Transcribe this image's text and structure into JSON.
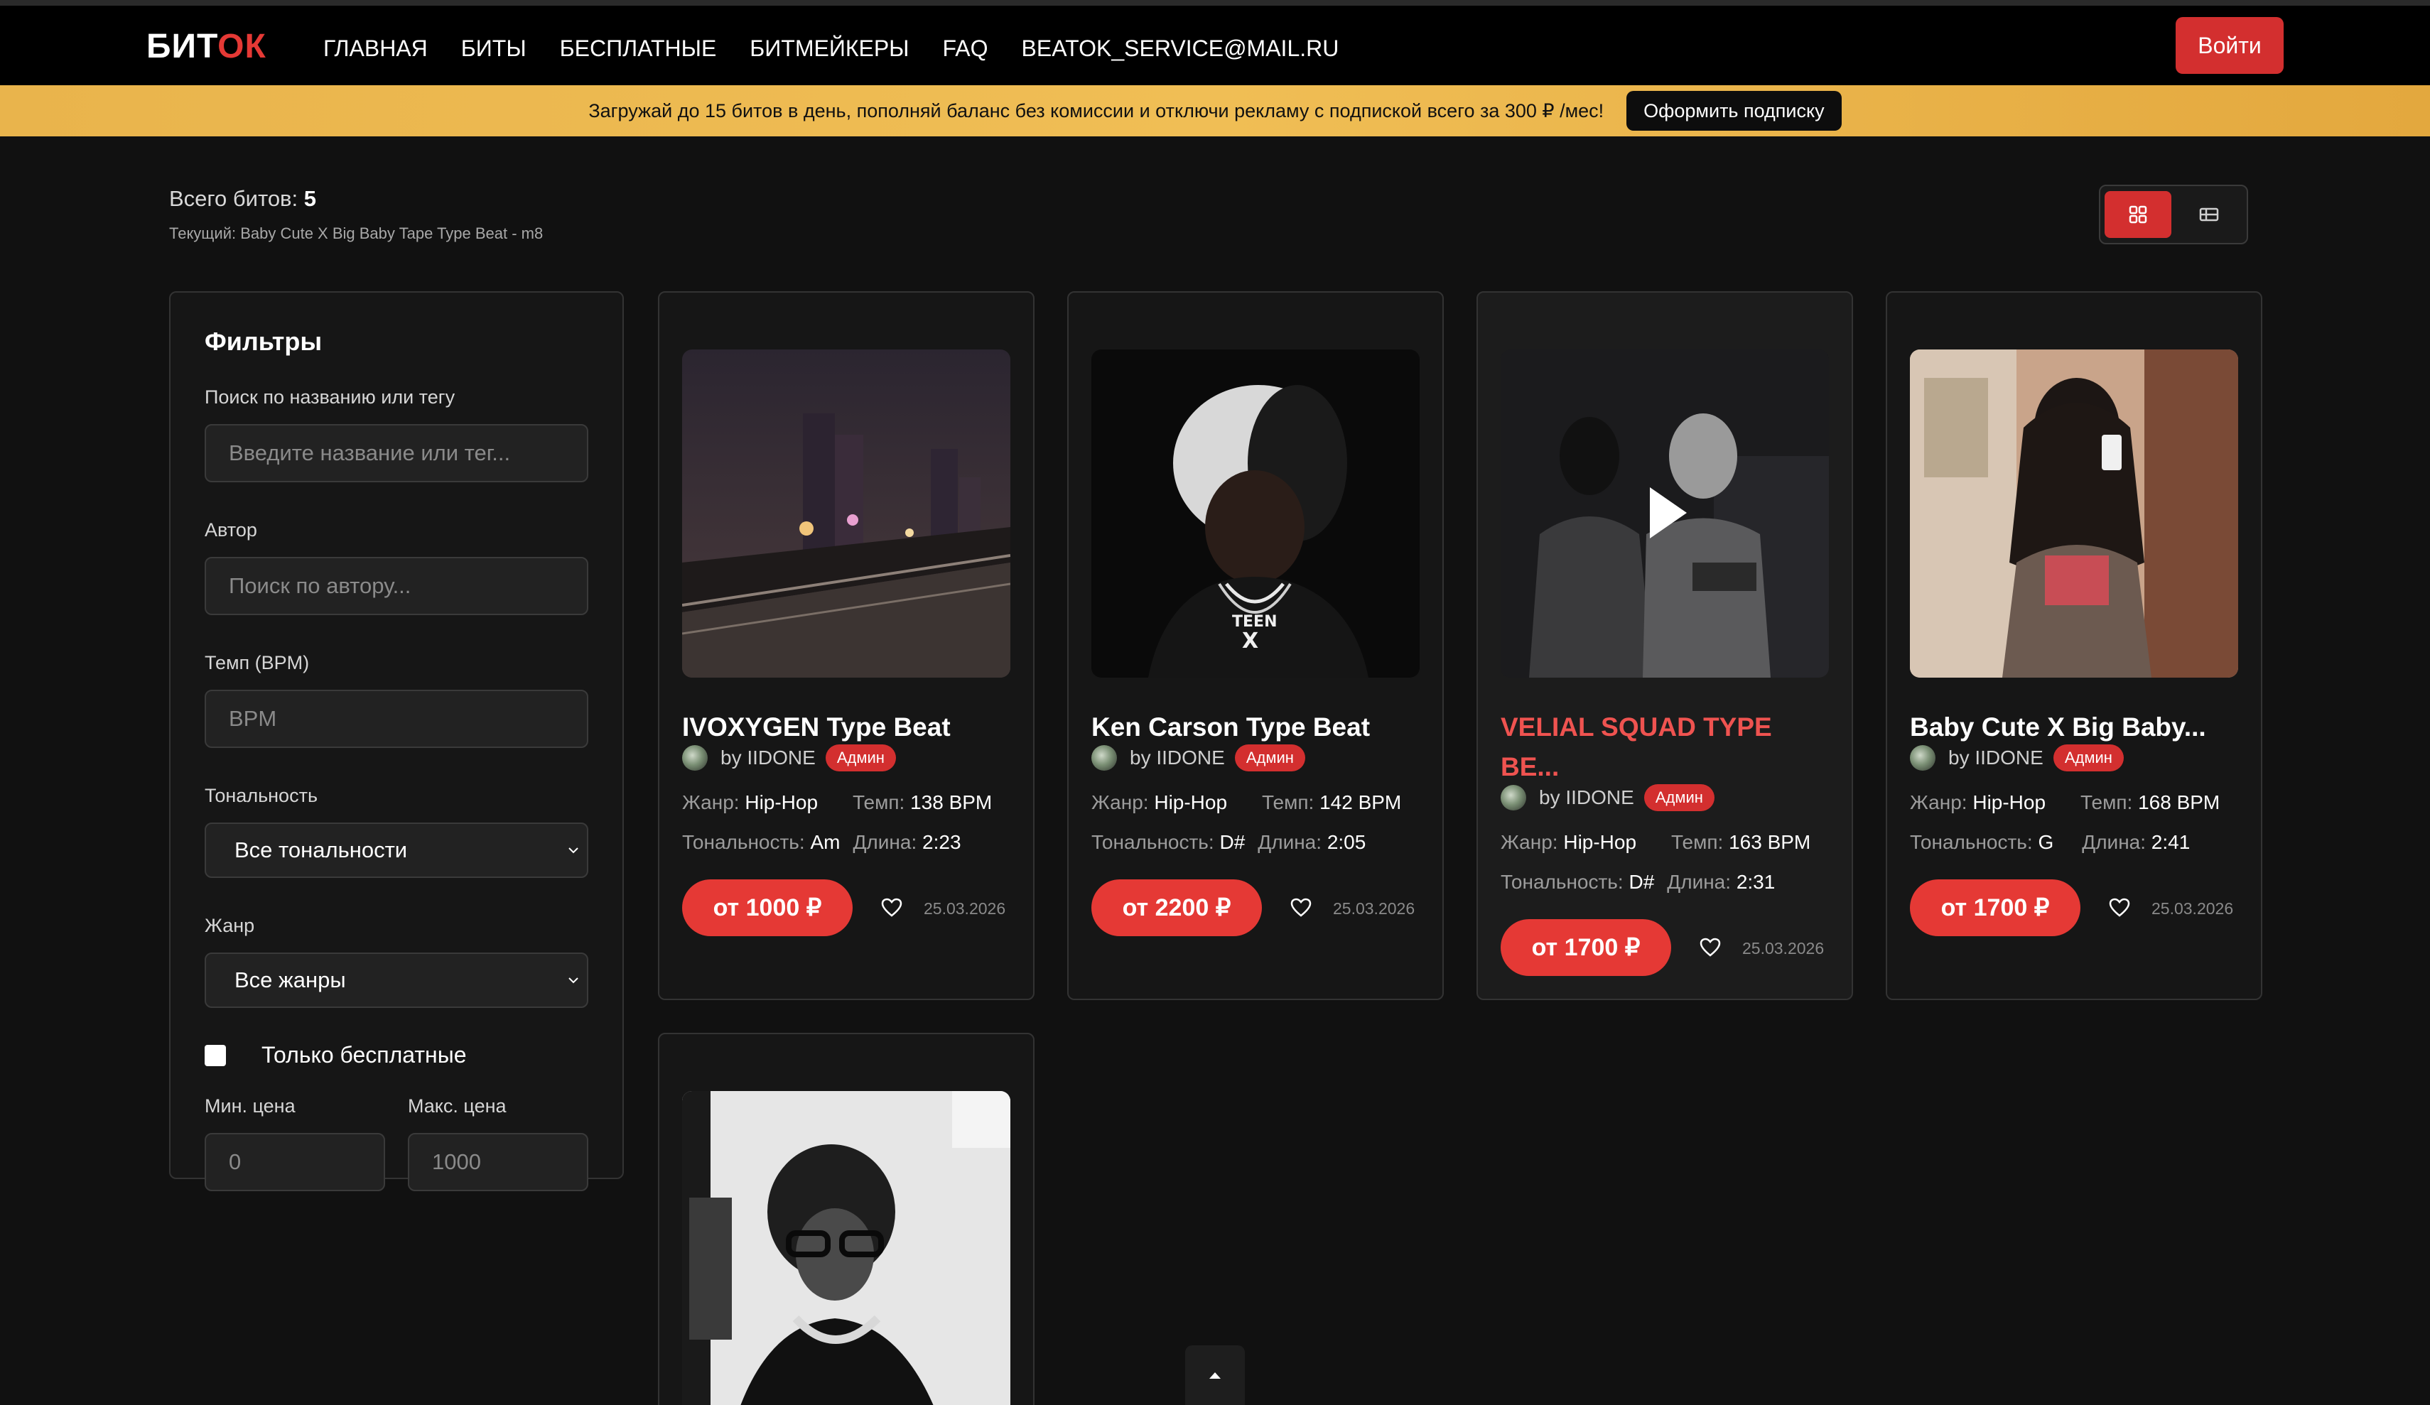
{
  "nav": {
    "logo_part1": "БИТ",
    "logo_part2": "ОК",
    "links": [
      "ГЛАВНАЯ",
      "БИТЫ",
      "БЕСПЛАТНЫЕ",
      "БИТМЕЙКЕРЫ",
      "FAQ",
      "BEATOK_SERVICE@MAIL.RU"
    ],
    "login_label": "Войти"
  },
  "promo": {
    "text": "Загружай до 15 битов в день, пополняй баланс без комиссии и отключи рекламу с подпиской всего за 300 ₽ /мес!",
    "button_label": "Оформить подписку"
  },
  "summary": {
    "total_label": "Всего битов:",
    "total_value": "5",
    "current_label": "Текущий: Baby Cute X Big Baby Tape Type Beat - m8"
  },
  "filters": {
    "title": "Фильтры",
    "search_label": "Поиск по названию или тегу",
    "search_placeholder": "Введите название или тег...",
    "author_label": "Автор",
    "author_placeholder": "Поиск по автору...",
    "bpm_label": "Темп (BPM)",
    "bpm_placeholder": "BPM",
    "key_label": "Тональность",
    "key_value": "Все тональности",
    "genre_label": "Жанр",
    "genre_value": "Все жанры",
    "free_only_label": "Только бесплатные",
    "min_price_label": "Мин. цена",
    "min_price_placeholder": "0",
    "max_price_label": "Макс. цена",
    "max_price_placeholder": "1000"
  },
  "labels": {
    "genre": "Жанр:",
    "tempo": "Темп:",
    "key": "Тональность:",
    "length": "Длина:"
  },
  "beats": [
    {
      "title": "IVOXYGEN Type Beat",
      "author": "by IIDONE",
      "badge": "Админ",
      "genre": "Hip-Hop",
      "tempo": "138 BPM",
      "key": "Am",
      "length": "2:23",
      "price": "от 1000 ₽",
      "date": "25.03.2026"
    },
    {
      "title": "Ken Carson Type Beat",
      "author": "by IIDONE",
      "badge": "Админ",
      "genre": "Hip-Hop",
      "tempo": "142 BPM",
      "key": "D#",
      "length": "2:05",
      "price": "от 2200 ₽",
      "date": "25.03.2026"
    },
    {
      "title": "VELIAL SQUAD TYPE BE...",
      "author": "by IIDONE",
      "badge": "Админ",
      "genre": "Hip-Hop",
      "tempo": "163 BPM",
      "key": "D#",
      "length": "2:31",
      "price": "от 1700 ₽",
      "date": "25.03.2026"
    },
    {
      "title": "Baby Cute X Big Baby...",
      "author": "by IIDONE",
      "badge": "Админ",
      "genre": "Hip-Hop",
      "tempo": "168 BPM",
      "key": "G",
      "length": "2:41",
      "price": "от 1700 ₽",
      "date": "25.03.2026"
    }
  ],
  "colors": {
    "accent": "#d32f2f",
    "price_button": "#e53935",
    "highlight_title": "#ef5350",
    "banner": "#f0be55",
    "background": "#111111"
  }
}
